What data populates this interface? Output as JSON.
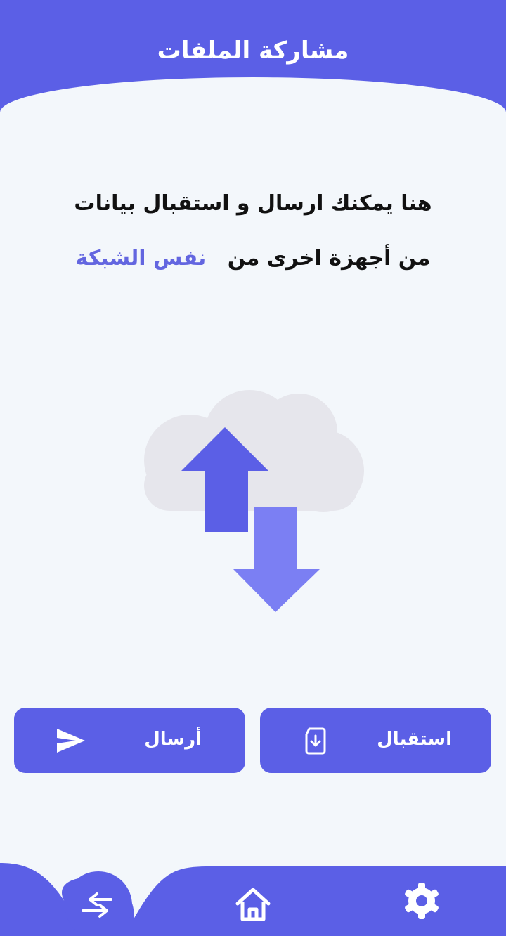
{
  "header": {
    "title": "مشاركة الملفات"
  },
  "intro": {
    "line1": "هنا يمكنك ارسال و استقبال بيانات",
    "line2_prefix": "من أجهزة اخرى من",
    "line2_highlight": "نفس الشبكة"
  },
  "hero": {
    "icon": "cloud-transfer-icon"
  },
  "actions": {
    "receive_label": "استقبال",
    "receive_icon": "file-download-icon",
    "send_label": "أرسال",
    "send_icon": "send-icon"
  },
  "bottom_nav": {
    "items": [
      {
        "icon": "swap-arrows-icon",
        "active": true
      },
      {
        "icon": "home-icon",
        "active": false
      },
      {
        "icon": "gear-icon",
        "active": false
      }
    ]
  },
  "colors": {
    "primary": "#5b5fe6",
    "primary_light": "#7b7ff3",
    "background": "#f3f7fb",
    "cloud": "#e6e6ec",
    "highlight_text": "#6366e0",
    "body_text": "#111111"
  }
}
